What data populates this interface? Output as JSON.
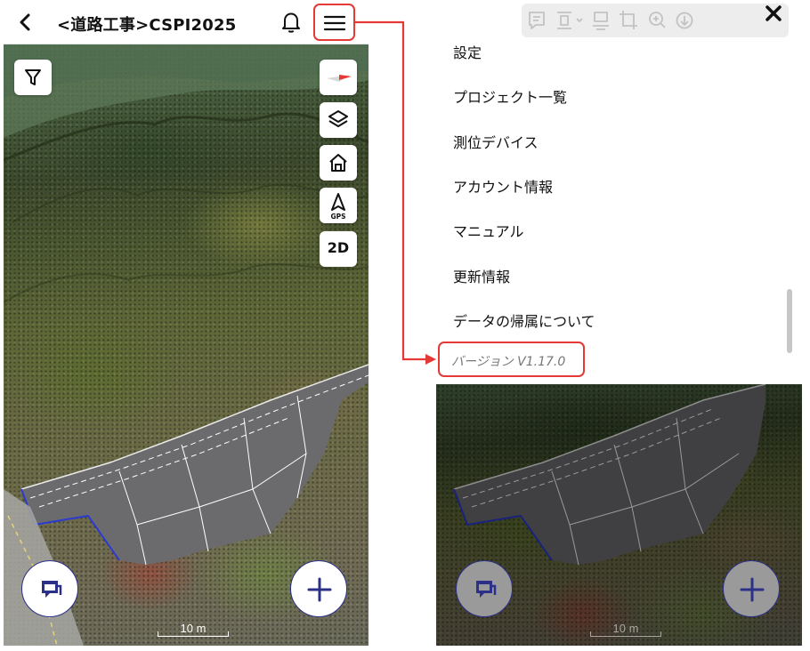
{
  "header": {
    "title": "<道路工事>CSPI2025"
  },
  "map": {
    "two_d_label": "2D",
    "gps_label": "GPS",
    "scale_label": "10 m"
  },
  "drawer": {
    "items": [
      {
        "label": "設定"
      },
      {
        "label": "プロジェクト一覧"
      },
      {
        "label": "測位デバイス"
      },
      {
        "label": "アカウント情報"
      },
      {
        "label": "マニュアル"
      },
      {
        "label": "更新情報"
      },
      {
        "label": "データの帰属について"
      }
    ],
    "version": "バージョン V1.17.0"
  },
  "colors": {
    "highlight": "#e53935",
    "fab_accent": "#2c3088",
    "road": "#6b6b6e"
  },
  "icons": [
    "back-chevron-icon",
    "bell-icon",
    "hamburger-menu-icon",
    "filter-icon",
    "compass-icon",
    "layers-icon",
    "home-icon",
    "gps-navigation-icon",
    "chat-icon",
    "plus-icon",
    "close-icon",
    "comment-icon",
    "frame-icon",
    "crop-icon",
    "zoom-icon",
    "download-icon"
  ]
}
